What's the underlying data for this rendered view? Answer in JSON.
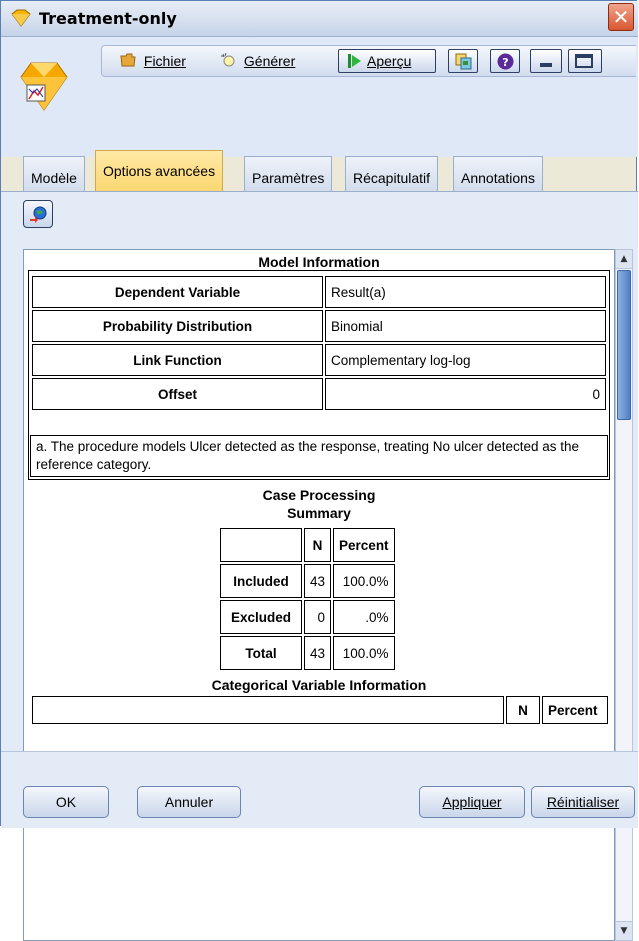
{
  "window": {
    "title": "Treatment-only",
    "close_label": "✕"
  },
  "toolbar": {
    "file_label": "Fichier",
    "generate_label": "Générer",
    "preview_label": "Aperçu"
  },
  "tabs": [
    {
      "label": "Modèle"
    },
    {
      "label": "Options avancées"
    },
    {
      "label": "Paramètres"
    },
    {
      "label": "Récapitulatif"
    },
    {
      "label": "Annotations"
    }
  ],
  "model_info": {
    "title": "Model Information",
    "rows": [
      {
        "label": "Dependent Variable",
        "value": "Result(a)"
      },
      {
        "label": "Probability Distribution",
        "value": "Binomial"
      },
      {
        "label": "Link Function",
        "value": "Complementary log-log"
      },
      {
        "label": "Offset",
        "value": "0"
      }
    ],
    "footnote": "a. The procedure models Ulcer detected as the response, treating No ulcer detected as the reference category."
  },
  "case_processing": {
    "title_line1": "Case Processing",
    "title_line2": "Summary",
    "headers": [
      "N",
      "Percent"
    ],
    "rows": [
      {
        "label": "Included",
        "n": "43",
        "percent": "100.0%"
      },
      {
        "label": "Excluded",
        "n": "0",
        "percent": ".0%"
      },
      {
        "label": "Total",
        "n": "43",
        "percent": "100.0%"
      }
    ]
  },
  "categorical_info": {
    "title": "Categorical Variable Information",
    "headers": [
      "N",
      "Percent"
    ]
  },
  "footer": {
    "ok_label": "OK",
    "cancel_label": "Annuler",
    "apply_label": "Appliquer",
    "reset_label": "Réinitialiser"
  },
  "colors": {
    "accent_tab": "#fcd770",
    "close_button": "#d9562f",
    "frame": "#5a7fb8"
  }
}
